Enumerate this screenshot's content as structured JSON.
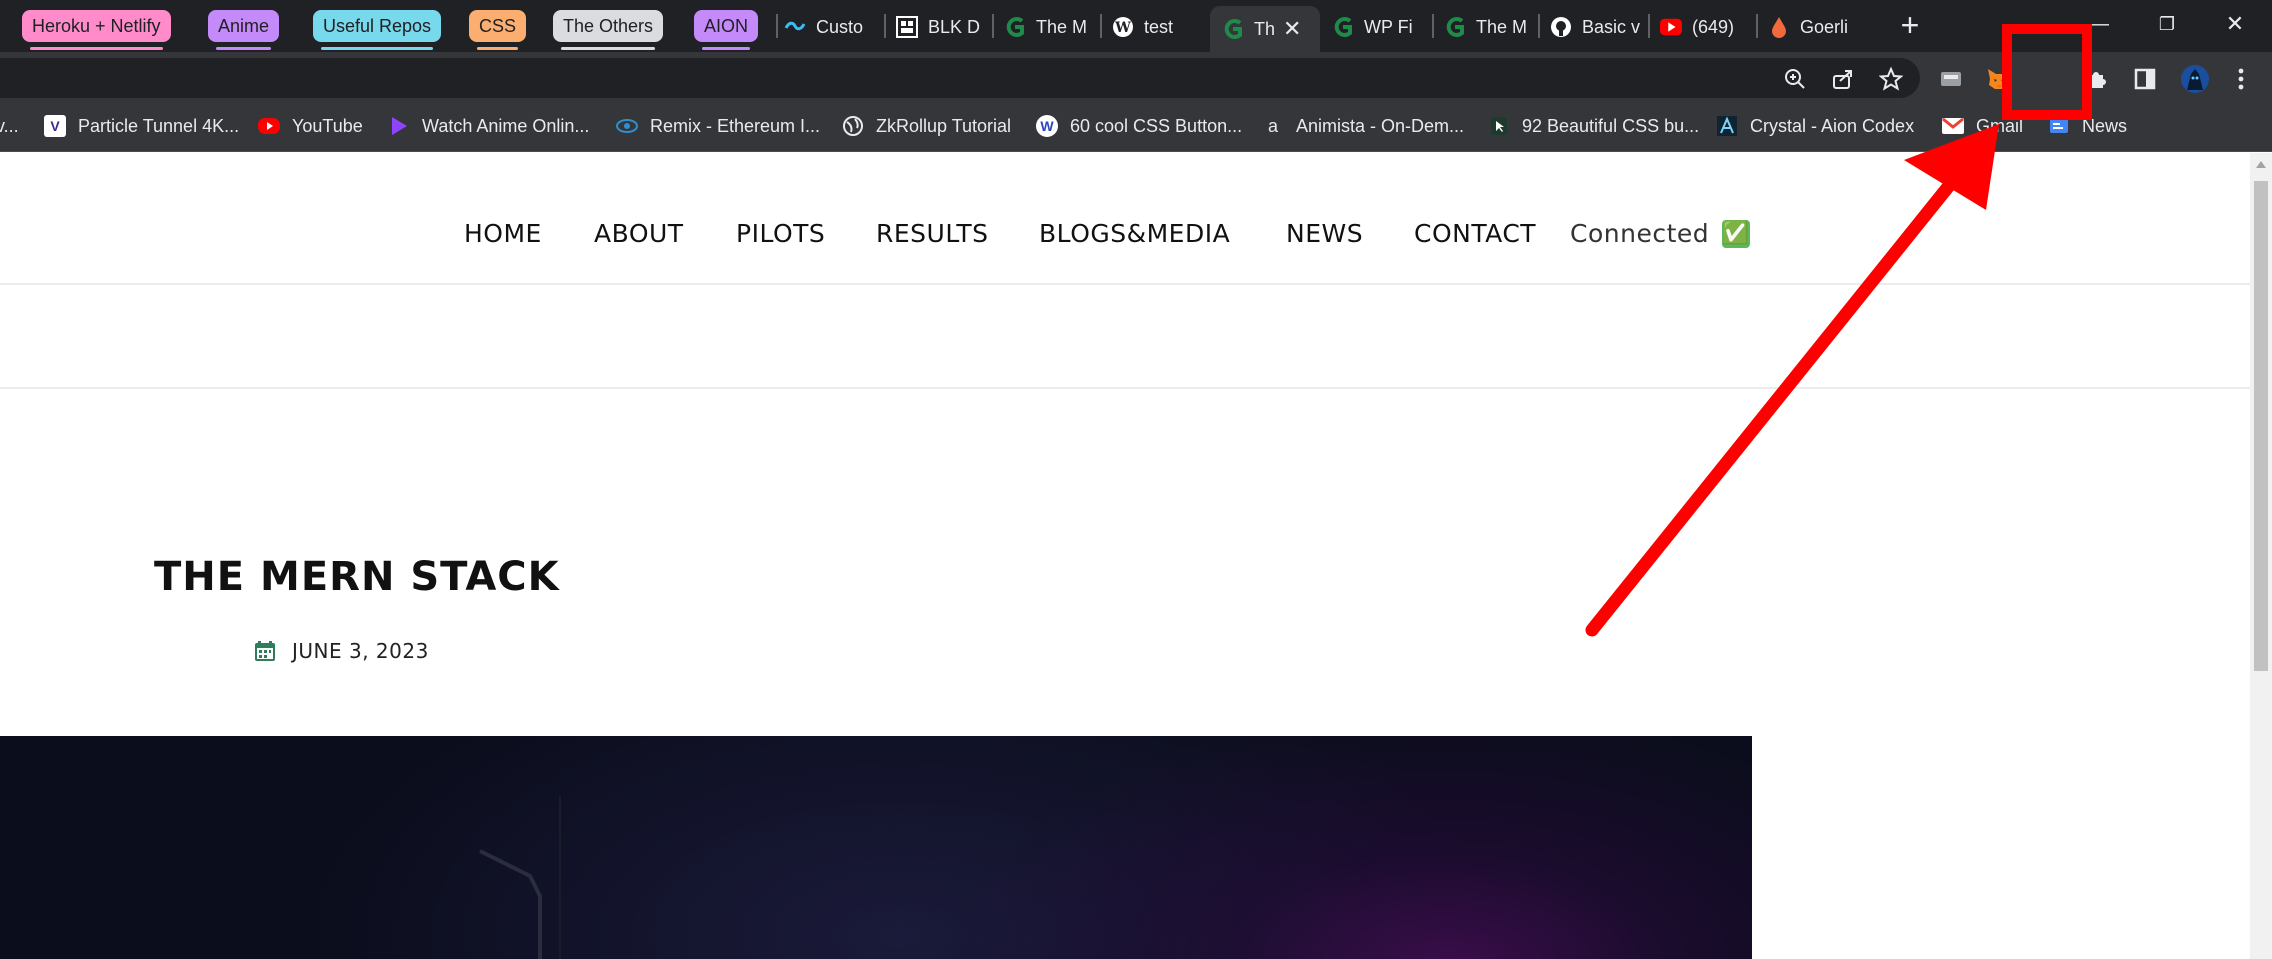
{
  "browser": {
    "tab_groups": [
      "Heroku + Netlify",
      "Anime",
      "Useful Repos",
      "CSS",
      "The Others",
      "AION"
    ],
    "tab_group_colors": [
      "#ff8bcb",
      "#c58af9",
      "#78d9ec",
      "#fcad70",
      "#dadce0",
      "#c58af9"
    ],
    "tabs": [
      "Custo",
      "BLK D",
      "The M",
      "test",
      "Th",
      "WP Fi",
      "The M",
      "Basic v",
      "(649)",
      "Goerli"
    ],
    "bookmarks": [
      "Particle Tunnel 4K...",
      "YouTube",
      "Watch Anime Onlin...",
      "Remix - Ethereum I...",
      "ZkRollup Tutorial",
      "60 cool CSS Button...",
      "Animista - On-Dem...",
      "92 Beautiful CSS bu...",
      "Crystal - Aion Codex",
      "Gmail",
      "News"
    ],
    "bookmark_prefix": "v...",
    "icons": [
      "zoom-icon",
      "share-icon",
      "star-icon",
      "extension-generic-icon",
      "metamask-fox-icon",
      "puzzle-extensions-icon",
      "side-panel-icon",
      "profile-avatar-icon",
      "menu-kebab-icon"
    ]
  },
  "site": {
    "nav": [
      "HOME",
      "ABOUT",
      "PILOTS",
      "RESULTS",
      "BLOGS&MEDIA",
      "NEWS",
      "CONTACT"
    ],
    "status": "Connected",
    "status_emoji": "✅"
  },
  "post": {
    "title": "THE MERN STACK",
    "date": "JUNE 3, 2023"
  },
  "annotation": {
    "highlight_color": "#ff0000",
    "target": "metamask-fox-icon"
  }
}
